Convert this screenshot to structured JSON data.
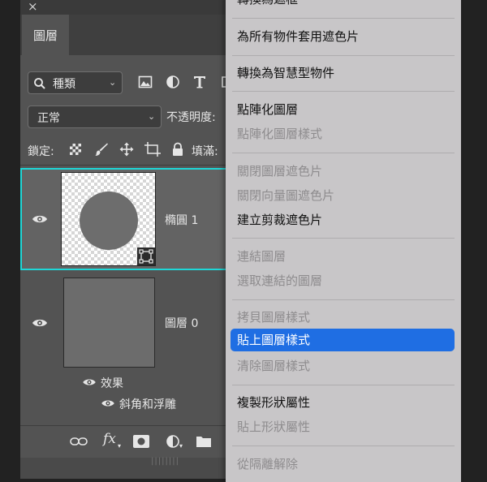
{
  "panel": {
    "close_glyph": "×",
    "tab_label": "圖層",
    "filter": {
      "kind_label": "種類",
      "icons": [
        "image-filter-icon",
        "adjustment-filter-icon",
        "text-filter-icon",
        "shape-filter-icon"
      ]
    },
    "blend_mode": "正常",
    "opacity_label": "不透明度:",
    "lock_label": "鎖定:",
    "lock_icons": [
      "lock-transparent-pixels-icon",
      "lock-image-pixels-icon",
      "lock-position-icon",
      "lock-artboard-icon",
      "lock-all-icon"
    ],
    "fill_label": "填滿:",
    "layers": [
      {
        "name": "橢圓 1",
        "selected": true,
        "visible": true,
        "type": "shape"
      },
      {
        "name": "圖層 0",
        "selected": false,
        "visible": true,
        "type": "pixel",
        "effects_label": "效果",
        "effects": [
          "斜角和浮雕"
        ]
      }
    ],
    "bottom_icons": [
      "link-layers-icon",
      "fx-icon",
      "add-mask-icon",
      "new-adjustment-icon",
      "new-group-icon"
    ],
    "fx_text": "fx"
  },
  "context_menu": {
    "items": [
      {
        "label": "轉換為遮框",
        "enabled": true
      },
      {
        "label": "為所有物件套用遮色片",
        "enabled": true
      },
      {
        "label": "轉換為智慧型物件",
        "enabled": true
      },
      {
        "label": "點陣化圖層",
        "enabled": true
      },
      {
        "label": "點陣化圖層樣式",
        "enabled": false
      },
      {
        "label": "關閉圖層遮色片",
        "enabled": false
      },
      {
        "label": "關閉向量圖遮色片",
        "enabled": false
      },
      {
        "label": "建立剪裁遮色片",
        "enabled": true
      },
      {
        "label": "連結圖層",
        "enabled": false
      },
      {
        "label": "選取連結的圖層",
        "enabled": false
      },
      {
        "label": "拷貝圖層樣式",
        "enabled": false
      },
      {
        "label": "貼上圖層樣式",
        "enabled": true,
        "highlighted": true
      },
      {
        "label": "清除圖層樣式",
        "enabled": false
      },
      {
        "label": "複製形狀屬性",
        "enabled": true
      },
      {
        "label": "貼上形狀屬性",
        "enabled": false
      },
      {
        "label": "從隔離解除",
        "enabled": false
      }
    ]
  },
  "colors": {
    "panel_bg": "#535353",
    "selection_outline": "#1ed7d7",
    "menu_bg": "#c8c6c8",
    "menu_highlight": "#1f6ee3"
  }
}
